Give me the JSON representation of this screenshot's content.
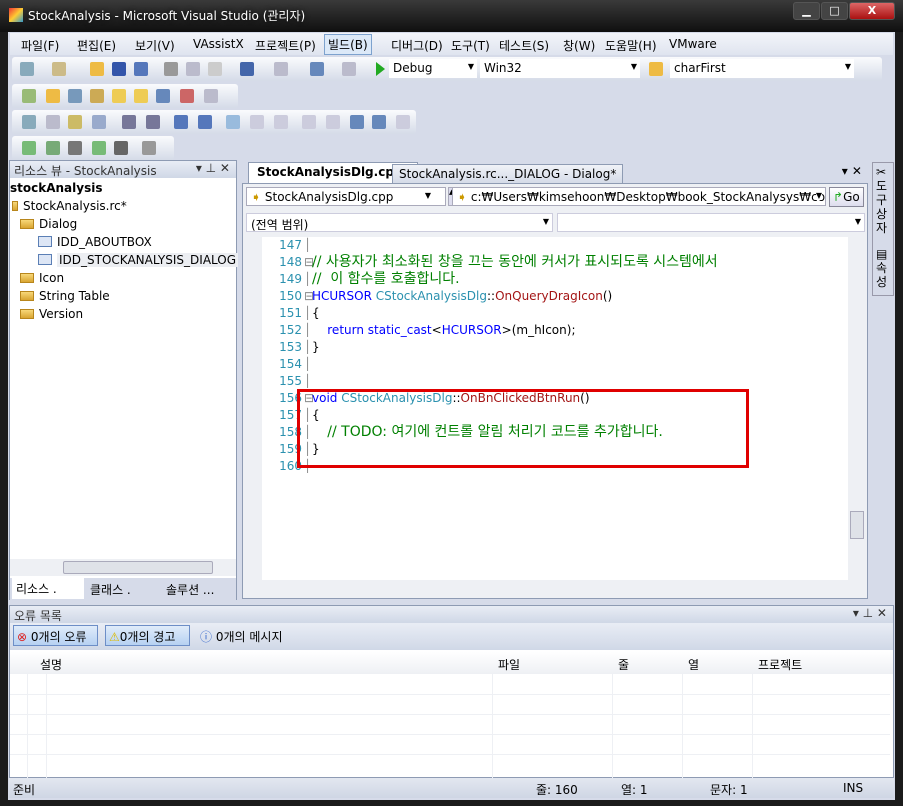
{
  "window": {
    "title": "StockAnalysis - Microsoft Visual Studio (관리자)",
    "min": "▁",
    "max": "□",
    "close": "X"
  },
  "menu": [
    "파일(F)",
    "편집(E)",
    "보기(V)",
    "VAssistX",
    "프로젝트(P)",
    "빌드(B)",
    "디버그(D)",
    "도구(T)",
    "테스트(S)",
    "창(W)",
    "도움말(H)",
    "VMware"
  ],
  "menu_active": "빌드(B)",
  "toolbar": {
    "config": "Debug",
    "platform": "Win32",
    "find": "charFirst"
  },
  "resource_view": {
    "title": "리소스 뷰 - StockAnalysis",
    "root": "stockAnalysis",
    "file": "StockAnalysis.rc*",
    "items": [
      {
        "label": "Dialog",
        "type": "folder"
      },
      {
        "label": "IDD_ABOUTBOX",
        "type": "dialog"
      },
      {
        "label": "IDD_STOCKANALYSIS_DIALOG",
        "type": "dialog",
        "selected": true
      },
      {
        "label": "Icon",
        "type": "folder"
      },
      {
        "label": "String Table",
        "type": "folder"
      },
      {
        "label": "Version",
        "type": "folder"
      }
    ],
    "tabs": [
      "리소스 .",
      "클래스 .",
      "솔루션 ..."
    ]
  },
  "editor": {
    "tabs": [
      {
        "label": "StockAnalysisDlg.cpp*",
        "active": true
      },
      {
        "label": "StockAnalysis.rc..._DIALOG - Dialog*",
        "active": false
      }
    ],
    "file_combo": "StockAnalysisDlg.cpp",
    "path_combo": "c:₩Users₩kimsehoon₩Desktop₩book_StockAnalysys₩code₩S",
    "go": "Go",
    "scope": "(전역 범위)",
    "lines": [
      {
        "n": "147",
        "parts": []
      },
      {
        "n": "148",
        "parts": [
          {
            "c": "cm",
            "t": "// 사용자가 최소화된 창을 끄는 동안에 커서가 표시되도록 시스템에서"
          }
        ]
      },
      {
        "n": "149",
        "parts": [
          {
            "c": "cm",
            "t": "//  이 함수를 호출합니다."
          }
        ]
      },
      {
        "n": "150",
        "parts": [
          {
            "c": "kw",
            "t": "HCURSOR "
          },
          {
            "c": "cls",
            "t": "CStockAnalysisDlg"
          },
          {
            "c": "",
            "t": "::"
          },
          {
            "c": "fn",
            "t": "OnQueryDragIcon"
          },
          {
            "c": "",
            "t": "()"
          }
        ]
      },
      {
        "n": "151",
        "parts": [
          {
            "c": "",
            "t": "{"
          }
        ]
      },
      {
        "n": "152",
        "parts": [
          {
            "c": "",
            "t": "    "
          },
          {
            "c": "kw",
            "t": "return static_cast"
          },
          {
            "c": "",
            "t": "<"
          },
          {
            "c": "kw",
            "t": "HCURSOR"
          },
          {
            "c": "",
            "t": ">(m_hIcon);"
          }
        ]
      },
      {
        "n": "153",
        "parts": [
          {
            "c": "",
            "t": "}"
          }
        ]
      },
      {
        "n": "154",
        "parts": []
      },
      {
        "n": "155",
        "parts": []
      },
      {
        "n": "156",
        "parts": [
          {
            "c": "kw",
            "t": "void "
          },
          {
            "c": "cls",
            "t": "CStockAnalysisDlg"
          },
          {
            "c": "",
            "t": "::"
          },
          {
            "c": "fn",
            "t": "OnBnClickedBtnRun"
          },
          {
            "c": "",
            "t": "()"
          }
        ]
      },
      {
        "n": "157",
        "parts": [
          {
            "c": "",
            "t": "{"
          }
        ]
      },
      {
        "n": "158",
        "parts": [
          {
            "c": "",
            "t": "    "
          },
          {
            "c": "cm",
            "t": "// TODO: 여기에 컨트롤 알림 처리기 코드를 추가합니다."
          }
        ]
      },
      {
        "n": "159",
        "parts": [
          {
            "c": "",
            "t": "}"
          }
        ]
      },
      {
        "n": "160",
        "parts": []
      }
    ]
  },
  "side_toolbar": [
    "도구 상자",
    "속성"
  ],
  "error_list": {
    "title": "오류 목록",
    "errors": "0개의 오류",
    "warnings": "0개의 경고",
    "messages": "0개의 메시지",
    "columns": [
      "설명",
      "파일",
      "줄",
      "열",
      "프로젝트"
    ]
  },
  "status": {
    "ready": "준비",
    "line": "줄: 160",
    "col": "열: 1",
    "char": "문자: 1",
    "mode": "INS"
  },
  "colors": {
    "highlight": "#e00000",
    "keyword": "#0000ff",
    "comment": "#008000",
    "type": "#2b91af"
  }
}
